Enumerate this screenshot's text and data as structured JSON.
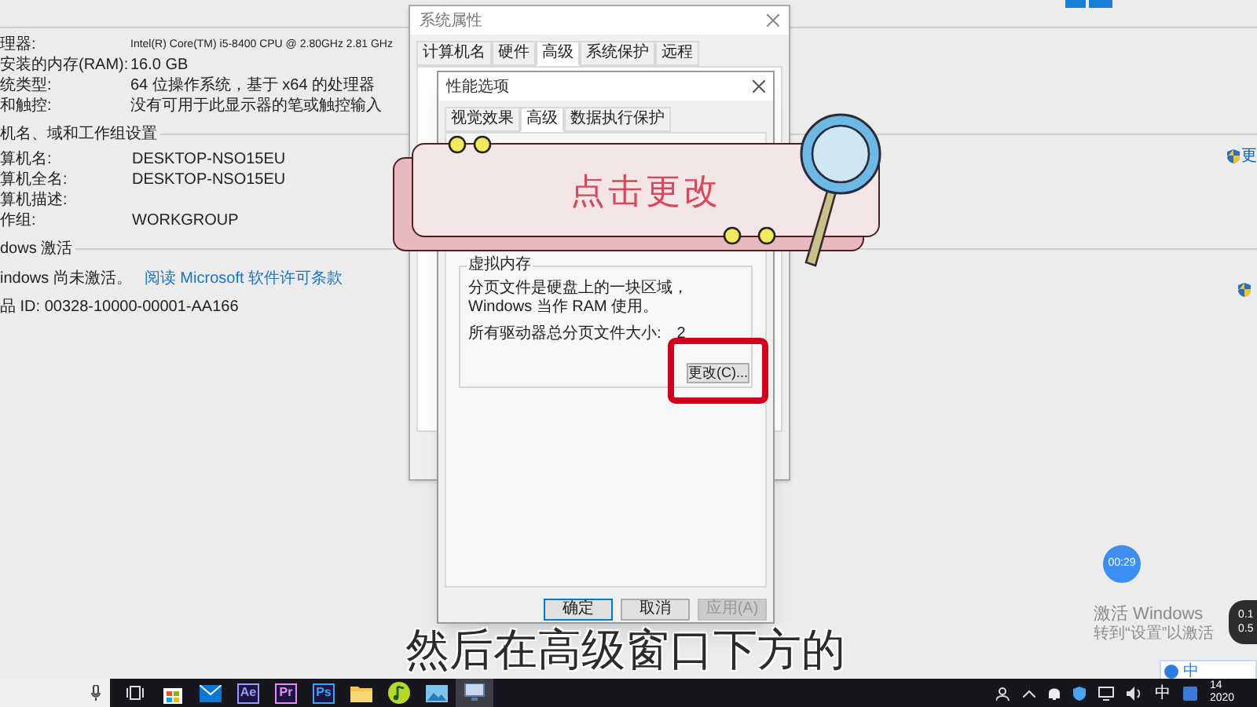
{
  "system_page": {
    "hardware_rows": [
      {
        "label": "理器:",
        "value": "Intel(R) Core(TM) i5-8400 CPU @ 2.80GHz   2.81 GHz"
      },
      {
        "label": "安装的内存(RAM):",
        "value": "16.0 GB"
      },
      {
        "label": "统类型:",
        "value": "64 位操作系统，基于 x64 的处理器"
      },
      {
        "label": "和触控:",
        "value": "没有可用于此显示器的笔或触控输入"
      }
    ],
    "sections": [
      {
        "heading": "机名、域和工作组设置",
        "side_link": "更",
        "rows": [
          {
            "kind": "pair",
            "label": "算机名:",
            "value": "DESKTOP-NSO15EU"
          },
          {
            "kind": "pair",
            "label": "算机全名:",
            "value": "DESKTOP-NSO15EU"
          },
          {
            "kind": "pair",
            "label": "算机描述:"
          },
          {
            "kind": "pair",
            "label": "作组:",
            "value": "WORKGROUP"
          }
        ]
      },
      {
        "heading": "dows 激活",
        "rows": [
          {
            "kind": "status",
            "label": "indows 尚未激活。",
            "link": "阅读 Microsoft 软件许可条款"
          },
          {
            "kind": "text",
            "label": "品 ID: 00328-10000-00001-AA166"
          }
        ]
      }
    ]
  },
  "system_properties": {
    "title": "系统属性",
    "tabs": [
      {
        "label": "计算机名",
        "selected": false
      },
      {
        "label": "硬件",
        "selected": false
      },
      {
        "label": "高级",
        "selected": true
      },
      {
        "label": "系统保护",
        "selected": false
      },
      {
        "label": "远程",
        "selected": false
      }
    ]
  },
  "performance_options": {
    "title": "性能选项",
    "tabs": [
      {
        "label": "视觉效果",
        "selected": false
      },
      {
        "label": "高级",
        "selected": true
      },
      {
        "label": "数据执行保护",
        "selected": false
      }
    ],
    "virtual_memory": {
      "heading": "虚拟内存",
      "description": "分页文件是硬盘上的一块区域，Windows 当作 RAM 使用。",
      "total_label": "所有驱动器总分页文件大小:",
      "total_value": "2",
      "change_button": "更改(C)..."
    },
    "buttons": [
      {
        "label": "确定",
        "disabled": false,
        "default": true
      },
      {
        "label": "取消",
        "disabled": false,
        "default": false
      },
      {
        "label": "应用(A)",
        "disabled": true,
        "default": false
      }
    ]
  },
  "callout": {
    "text": "点击更改"
  },
  "subtitle": "然后在高级窗口下方的",
  "timer": "00:29",
  "activation_notice": {
    "title": "激活 Windows",
    "hint": "转到“设置”以激活"
  },
  "network_speed": {
    "upload": "0.1",
    "download": "0.5"
  },
  "ime_toolbar": {
    "mode": "中"
  },
  "taskbar": {
    "apps": [
      {
        "kind": "taskview",
        "selected": false
      },
      {
        "kind": "store",
        "selected": false
      },
      {
        "kind": "mail",
        "selected": false
      },
      {
        "kind": "badge",
        "label": "Ae",
        "color": "#9999ff",
        "selected": false
      },
      {
        "kind": "badge",
        "label": "Pr",
        "color": "#e88ef7",
        "selected": false
      },
      {
        "kind": "badge",
        "label": "Ps",
        "color": "#31a8ff",
        "selected": false
      },
      {
        "kind": "folder",
        "selected": false
      },
      {
        "kind": "music",
        "selected": false
      },
      {
        "kind": "photos",
        "selected": false
      },
      {
        "kind": "system",
        "selected": true
      }
    ],
    "tray": {
      "ime": "中",
      "clock_time": "14",
      "clock_date": "2020"
    }
  }
}
